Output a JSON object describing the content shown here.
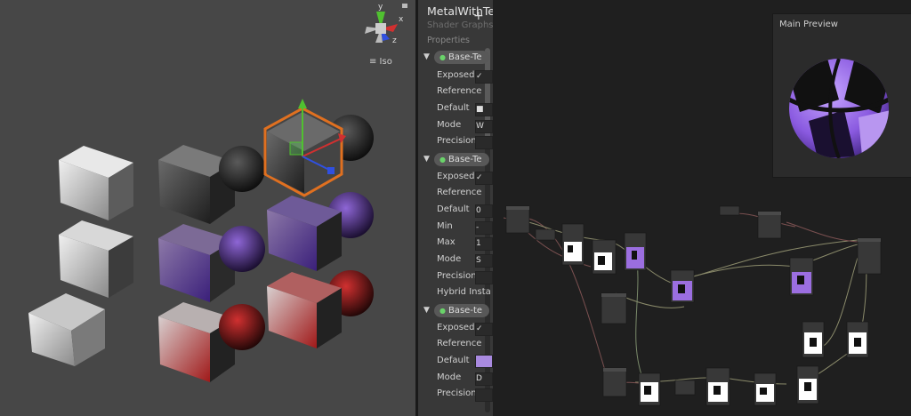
{
  "scene": {
    "gizmo": {
      "label": "≡ Iso",
      "axes": [
        "y",
        "x",
        "z"
      ]
    }
  },
  "blackboard": {
    "title": "MetalWithTex",
    "subtitle": "Shader Graphs",
    "add_label": "+",
    "section_label": "Properties",
    "groups": [
      {
        "name": "Base-Te",
        "rows": [
          {
            "label": "Exposed",
            "value": "✓"
          },
          {
            "label": "Reference",
            "value": ""
          },
          {
            "label": "Default",
            "value": "■"
          },
          {
            "label": "Mode",
            "value": "W"
          },
          {
            "label": "Precision",
            "value": ""
          }
        ]
      },
      {
        "name": "Base-Te",
        "rows": [
          {
            "label": "Exposed",
            "value": "✓"
          },
          {
            "label": "Reference",
            "value": ""
          },
          {
            "label": "Default",
            "value": "0"
          },
          {
            "label": "Min",
            "value": "-"
          },
          {
            "label": "Max",
            "value": "1"
          },
          {
            "label": "Mode",
            "value": "S"
          },
          {
            "label": "Precision",
            "value": ""
          },
          {
            "label": "Hybrid Insta",
            "value": ""
          }
        ]
      },
      {
        "name": "Base-te",
        "rows": [
          {
            "label": "Exposed",
            "value": "✓"
          },
          {
            "label": "Reference",
            "value": ""
          },
          {
            "label": "Default",
            "value": ""
          },
          {
            "label": "Mode",
            "value": "D"
          },
          {
            "label": "Precision",
            "value": ""
          }
        ]
      }
    ]
  },
  "preview": {
    "title": "Main Preview"
  },
  "colors": {
    "accent_purple": "#9b6ee0",
    "selection_orange": "#e07020",
    "axis_x": "#d03030",
    "axis_y": "#50c030",
    "axis_z": "#3050e0"
  }
}
